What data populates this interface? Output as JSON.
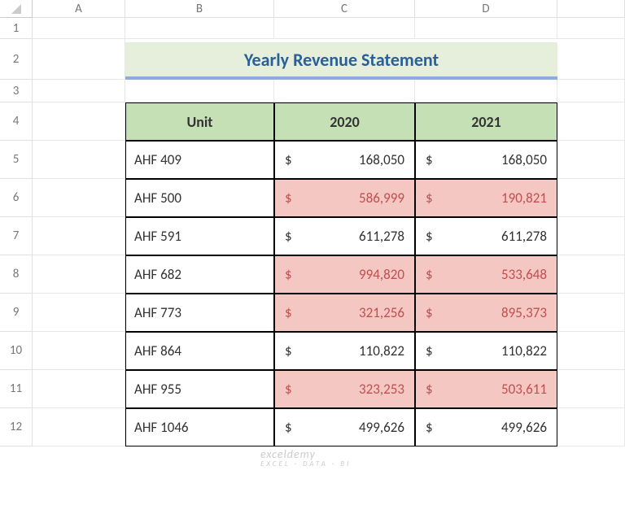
{
  "columns": [
    "A",
    "B",
    "C",
    "D"
  ],
  "rows": [
    "1",
    "2",
    "3",
    "4",
    "5",
    "6",
    "7",
    "8",
    "9",
    "10",
    "11",
    "12"
  ],
  "title": "Yearly Revenue Statement",
  "headers": {
    "unit": "Unit",
    "y1": "2020",
    "y2": "2021"
  },
  "currency": "$",
  "data": [
    {
      "unit": "AHF 409",
      "y1": "168,050",
      "y2": "168,050",
      "hl": false
    },
    {
      "unit": "AHF 500",
      "y1": "586,999",
      "y2": "190,821",
      "hl": true
    },
    {
      "unit": "AHF 591",
      "y1": "611,278",
      "y2": "611,278",
      "hl": false
    },
    {
      "unit": "AHF 682",
      "y1": "994,820",
      "y2": "533,648",
      "hl": true
    },
    {
      "unit": "AHF 773",
      "y1": "321,256",
      "y2": "895,373",
      "hl": true
    },
    {
      "unit": "AHF 864",
      "y1": "110,822",
      "y2": "110,822",
      "hl": false
    },
    {
      "unit": "AHF 955",
      "y1": "323,253",
      "y2": "503,611",
      "hl": true
    },
    {
      "unit": "AHF 1046",
      "y1": "499,626",
      "y2": "499,626",
      "hl": false
    }
  ],
  "watermark": {
    "main": "exceldemy",
    "sub": "EXCEL · DATA · BI"
  },
  "chart_data": {
    "type": "table",
    "title": "Yearly Revenue Statement",
    "columns": [
      "Unit",
      "2020",
      "2021"
    ],
    "rows": [
      [
        "AHF 409",
        168050,
        168050
      ],
      [
        "AHF 500",
        586999,
        190821
      ],
      [
        "AHF 591",
        611278,
        611278
      ],
      [
        "AHF 682",
        994820,
        533648
      ],
      [
        "AHF 773",
        321256,
        895373
      ],
      [
        "AHF 864",
        110822,
        110822
      ],
      [
        "AHF 955",
        323253,
        503611
      ],
      [
        "AHF 1046",
        499626,
        499626
      ]
    ]
  }
}
